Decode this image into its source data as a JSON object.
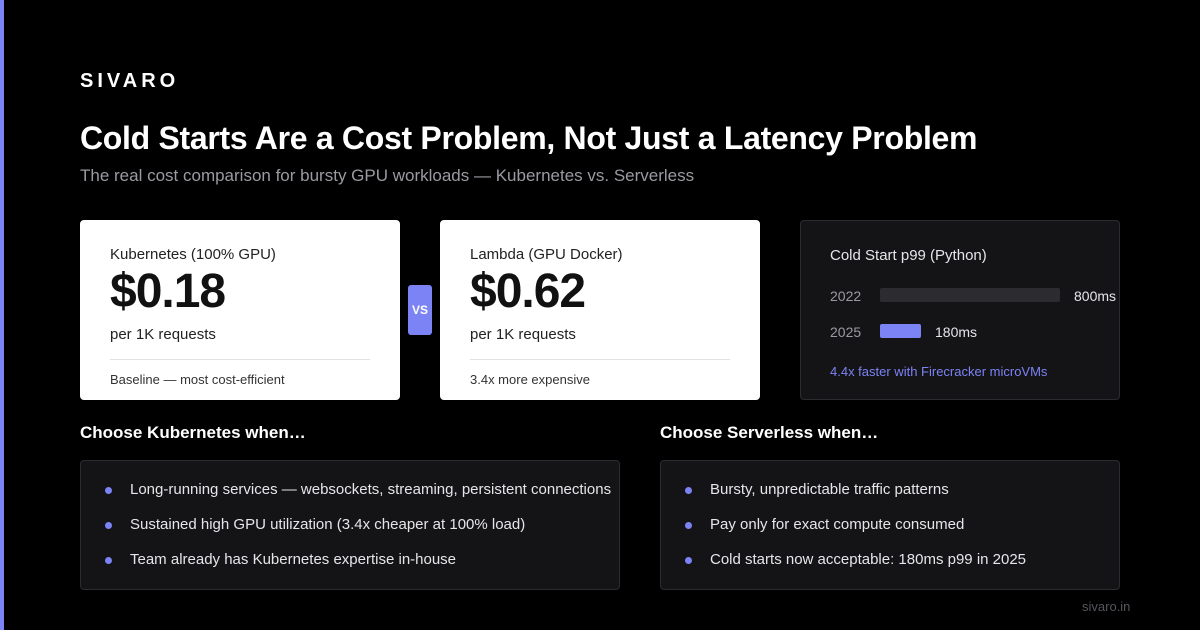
{
  "brand": "SIVARO",
  "title": "Cold Starts Are a Cost Problem, Not Just a Latency Problem",
  "subtitle": "The real cost comparison for bursty GPU workloads — Kubernetes vs. Serverless",
  "kubernetes_card": {
    "label": "Kubernetes (100% GPU)",
    "price": "$0.18",
    "unit": "per 1K requests",
    "note": "Baseline — most cost-efficient"
  },
  "vs_label": "VS",
  "lambda_card": {
    "label": "Lambda (GPU Docker)",
    "price": "$0.62",
    "unit": "per 1K requests",
    "note": "3.4x more expensive"
  },
  "cold_start": {
    "title": "Cold Start p99 (Python)",
    "rows": [
      {
        "year": "2022",
        "value": "800ms",
        "ms": 800,
        "color": "#2c2c30"
      },
      {
        "year": "2025",
        "value": "180ms",
        "ms": 180,
        "color": "#7c83f5"
      }
    ],
    "note": "4.4x faster with Firecracker microVMs"
  },
  "choose_kubernetes": {
    "heading": "Choose Kubernetes when…",
    "items": [
      "Long-running services — websockets, streaming, persistent connections",
      "Sustained high GPU utilization (3.4x cheaper at 100% load)",
      "Team already has Kubernetes expertise in-house"
    ]
  },
  "choose_serverless": {
    "heading": "Choose Serverless when…",
    "items": [
      "Bursty, unpredictable traffic patterns",
      "Pay only for exact compute consumed",
      "Cold starts now acceptable: 180ms p99 in 2025"
    ]
  },
  "footer": "sivaro.in",
  "colors": {
    "accent": "#7c83f5",
    "background": "#000000",
    "card_dark": "#141416"
  }
}
